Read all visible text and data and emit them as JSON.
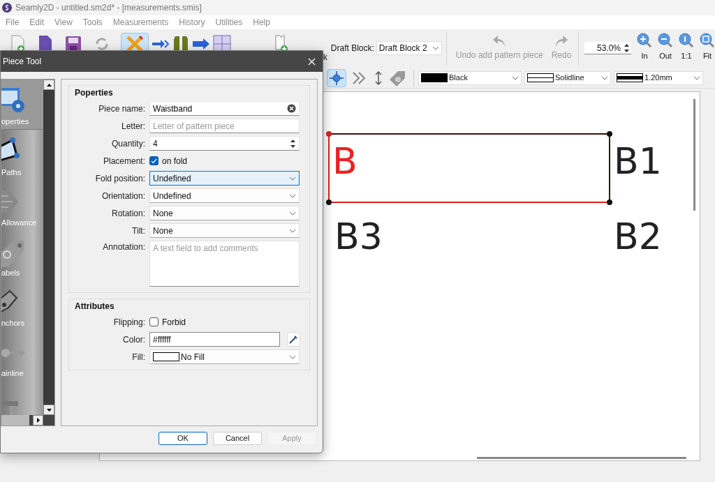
{
  "window": {
    "title": "Seamly2D - untitled.sm2d* - [measurements.smis]"
  },
  "menu": [
    "File",
    "Edit",
    "View",
    "Tools",
    "Measurements",
    "History",
    "Utilities",
    "Help"
  ],
  "toolbar": {
    "hidden_label": "k",
    "draft_block_label": "Draft Block:",
    "draft_block_value": "Draft Block 2",
    "undo": {
      "label": "Undo add pattern piece",
      "disabled": true
    },
    "redo": {
      "label": "Redo",
      "disabled": true
    },
    "zoom_value": "53.0%",
    "zoom_buttons": [
      {
        "kind": "in",
        "label": "In"
      },
      {
        "kind": "out",
        "label": "Out"
      },
      {
        "kind": "one",
        "label": "1:1"
      },
      {
        "kind": "fit",
        "label": "Fit"
      }
    ]
  },
  "line_toolbar": {
    "color": {
      "label": "Black"
    },
    "line_type": "Solidline",
    "line_weight": "1.20mm"
  },
  "canvas": {
    "points": [
      {
        "label": "B",
        "color": "#ee2020"
      },
      {
        "label": "B1",
        "color": "#222222"
      },
      {
        "label": "B3",
        "color": "#222222"
      },
      {
        "label": "B2",
        "color": "#222222"
      }
    ]
  },
  "dialog": {
    "title": "Piece Tool",
    "sidebar": [
      {
        "kind": "properties",
        "label": "operties",
        "selected": true
      },
      {
        "kind": "paths",
        "label": "Paths",
        "selected": false
      },
      {
        "kind": "allowance",
        "label": "Allowance",
        "selected": false
      },
      {
        "kind": "labels",
        "label": "abels",
        "selected": false
      },
      {
        "kind": "anchors",
        "label": "nchors",
        "selected": false
      },
      {
        "kind": "grainline",
        "label": "ainline",
        "selected": false
      },
      {
        "kind": "pins",
        "selected": false
      }
    ],
    "properties": {
      "title": "Poperties",
      "fields": [
        {
          "kind": "text",
          "label": "Piece name:",
          "value": "Waistband"
        },
        {
          "kind": "placeholder",
          "label": "Letter:",
          "placeholder": "Letter of pattern piece"
        },
        {
          "kind": "spin",
          "label": "Quantity:",
          "value": "4"
        },
        {
          "kind": "check",
          "label": "Placement:",
          "text": "on fold",
          "checked": true
        },
        {
          "kind": "select",
          "label": "Fold position:",
          "value": "Undefined",
          "focused": true
        },
        {
          "kind": "select",
          "label": "Orientation:",
          "value": "Undefined",
          "focused": false
        },
        {
          "kind": "select",
          "label": "Rotation:",
          "value": "None",
          "focused": false
        },
        {
          "kind": "select",
          "label": "Tilt:",
          "value": "None",
          "focused": false
        },
        {
          "kind": "area",
          "label": "Annotation:",
          "placeholder": "A text field to add comments"
        }
      ]
    },
    "attributes": {
      "title": "Attributes",
      "fields": [
        {
          "kind": "check",
          "label": "Flipping:",
          "text": "Forbid",
          "checked": false
        },
        {
          "kind": "color",
          "label": "Color:",
          "value": "#ffffff"
        },
        {
          "kind": "fill",
          "label": "Fill:",
          "value": "No Fill"
        }
      ]
    },
    "buttons": [
      {
        "label": "OK",
        "default": true,
        "disabled": false
      },
      {
        "label": "Cancel",
        "default": false,
        "disabled": false
      },
      {
        "label": "Apply",
        "default": false,
        "disabled": true
      }
    ]
  }
}
